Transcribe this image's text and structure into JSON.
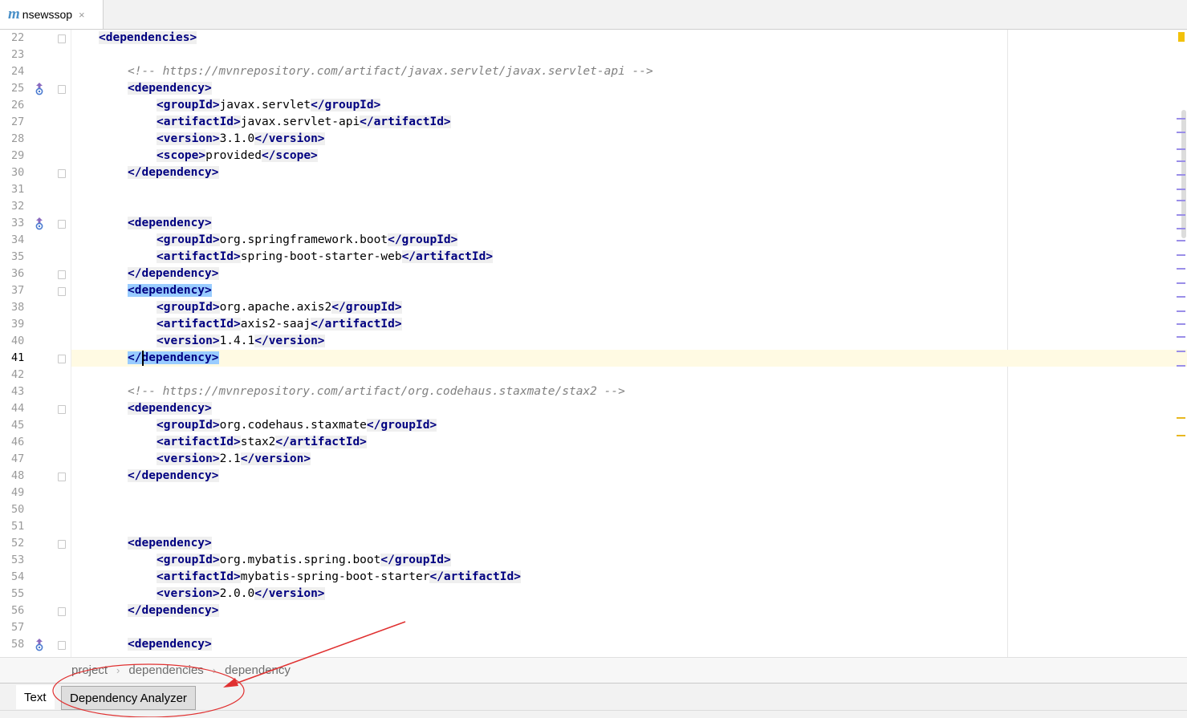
{
  "tab": {
    "icon": "maven-icon",
    "filename": "nsewssop",
    "close_symbol": "×"
  },
  "lines": [
    {
      "n": "22",
      "fold": true,
      "icon": false,
      "indent": 1,
      "segments": [
        [
          "t",
          "<dependencies>"
        ]
      ]
    },
    {
      "n": "23",
      "fold": false,
      "icon": false,
      "indent": 0,
      "segments": []
    },
    {
      "n": "24",
      "fold": false,
      "icon": false,
      "indent": 2,
      "segments": [
        [
          "c",
          "<!-- https://mvnrepository.com/artifact/javax.servlet/javax.servlet-api -->"
        ]
      ]
    },
    {
      "n": "25",
      "fold": true,
      "icon": true,
      "indent": 2,
      "segments": [
        [
          "t",
          "<dependency>"
        ]
      ]
    },
    {
      "n": "26",
      "fold": false,
      "icon": false,
      "indent": 3,
      "segments": [
        [
          "t",
          "<groupId>"
        ],
        [
          "x",
          "javax.servlet"
        ],
        [
          "t",
          "</groupId>"
        ]
      ]
    },
    {
      "n": "27",
      "fold": false,
      "icon": false,
      "indent": 3,
      "segments": [
        [
          "t",
          "<artifactId>"
        ],
        [
          "x",
          "javax.servlet-api"
        ],
        [
          "t",
          "</artifactId>"
        ]
      ]
    },
    {
      "n": "28",
      "fold": false,
      "icon": false,
      "indent": 3,
      "segments": [
        [
          "t",
          "<version>"
        ],
        [
          "x",
          "3.1.0"
        ],
        [
          "t",
          "</version>"
        ]
      ]
    },
    {
      "n": "29",
      "fold": false,
      "icon": false,
      "indent": 3,
      "segments": [
        [
          "t",
          "<scope>"
        ],
        [
          "x",
          "provided"
        ],
        [
          "t",
          "</scope>"
        ]
      ]
    },
    {
      "n": "30",
      "fold": true,
      "icon": false,
      "indent": 2,
      "segments": [
        [
          "t",
          "</dependency>"
        ]
      ]
    },
    {
      "n": "31",
      "fold": false,
      "icon": false,
      "indent": 0,
      "segments": []
    },
    {
      "n": "32",
      "fold": false,
      "icon": false,
      "indent": 0,
      "segments": []
    },
    {
      "n": "33",
      "fold": true,
      "icon": true,
      "indent": 2,
      "segments": [
        [
          "t",
          "<dependency>"
        ]
      ]
    },
    {
      "n": "34",
      "fold": false,
      "icon": false,
      "indent": 3,
      "segments": [
        [
          "t",
          "<groupId>"
        ],
        [
          "x",
          "org.springframework.boot"
        ],
        [
          "t",
          "</groupId>"
        ]
      ]
    },
    {
      "n": "35",
      "fold": false,
      "icon": false,
      "indent": 3,
      "segments": [
        [
          "t",
          "<artifactId>"
        ],
        [
          "x",
          "spring-boot-starter-web"
        ],
        [
          "t",
          "</artifactId>"
        ]
      ]
    },
    {
      "n": "36",
      "fold": true,
      "icon": false,
      "indent": 2,
      "segments": [
        [
          "t",
          "</dependency>"
        ]
      ]
    },
    {
      "n": "37",
      "fold": true,
      "icon": false,
      "indent": 2,
      "segments": [
        [
          "h",
          "<dependency>"
        ]
      ]
    },
    {
      "n": "38",
      "fold": false,
      "icon": false,
      "indent": 3,
      "segments": [
        [
          "t",
          "<groupId>"
        ],
        [
          "x",
          "org.apache.axis2"
        ],
        [
          "t",
          "</groupId>"
        ]
      ]
    },
    {
      "n": "39",
      "fold": false,
      "icon": false,
      "indent": 3,
      "segments": [
        [
          "t",
          "<artifactId>"
        ],
        [
          "x",
          "axis2-saaj"
        ],
        [
          "t",
          "</artifactId>"
        ]
      ]
    },
    {
      "n": "40",
      "fold": false,
      "icon": false,
      "indent": 3,
      "segments": [
        [
          "t",
          "<version>"
        ],
        [
          "x",
          "1.4.1"
        ],
        [
          "t",
          "</version>"
        ]
      ]
    },
    {
      "n": "41",
      "fold": true,
      "icon": false,
      "indent": 2,
      "current": true,
      "segments": [
        [
          "h",
          "</dependency>"
        ]
      ]
    },
    {
      "n": "42",
      "fold": false,
      "icon": false,
      "indent": 0,
      "segments": []
    },
    {
      "n": "43",
      "fold": false,
      "icon": false,
      "indent": 2,
      "segments": [
        [
          "c",
          "<!-- https://mvnrepository.com/artifact/org.codehaus.staxmate/stax2 -->"
        ]
      ]
    },
    {
      "n": "44",
      "fold": true,
      "icon": false,
      "indent": 2,
      "segments": [
        [
          "t",
          "<dependency>"
        ]
      ]
    },
    {
      "n": "45",
      "fold": false,
      "icon": false,
      "indent": 3,
      "segments": [
        [
          "t",
          "<groupId>"
        ],
        [
          "x",
          "org.codehaus.staxmate"
        ],
        [
          "t",
          "</groupId>"
        ]
      ]
    },
    {
      "n": "46",
      "fold": false,
      "icon": false,
      "indent": 3,
      "segments": [
        [
          "t",
          "<artifactId>"
        ],
        [
          "x",
          "stax2"
        ],
        [
          "t",
          "</artifactId>"
        ]
      ]
    },
    {
      "n": "47",
      "fold": false,
      "icon": false,
      "indent": 3,
      "segments": [
        [
          "t",
          "<version>"
        ],
        [
          "x",
          "2.1"
        ],
        [
          "t",
          "</version>"
        ]
      ]
    },
    {
      "n": "48",
      "fold": true,
      "icon": false,
      "indent": 2,
      "segments": [
        [
          "t",
          "</dependency>"
        ]
      ]
    },
    {
      "n": "49",
      "fold": false,
      "icon": false,
      "indent": 0,
      "segments": []
    },
    {
      "n": "50",
      "fold": false,
      "icon": false,
      "indent": 0,
      "segments": []
    },
    {
      "n": "51",
      "fold": false,
      "icon": false,
      "indent": 0,
      "segments": []
    },
    {
      "n": "52",
      "fold": true,
      "icon": false,
      "indent": 2,
      "segments": [
        [
          "t",
          "<dependency>"
        ]
      ]
    },
    {
      "n": "53",
      "fold": false,
      "icon": false,
      "indent": 3,
      "segments": [
        [
          "t",
          "<groupId>"
        ],
        [
          "x",
          "org.mybatis.spring.boot"
        ],
        [
          "t",
          "</groupId>"
        ]
      ]
    },
    {
      "n": "54",
      "fold": false,
      "icon": false,
      "indent": 3,
      "segments": [
        [
          "t",
          "<artifactId>"
        ],
        [
          "x",
          "mybatis-spring-boot-starter"
        ],
        [
          "t",
          "</artifactId>"
        ]
      ]
    },
    {
      "n": "55",
      "fold": false,
      "icon": false,
      "indent": 3,
      "segments": [
        [
          "t",
          "<version>"
        ],
        [
          "x",
          "2.0.0"
        ],
        [
          "t",
          "</version>"
        ]
      ]
    },
    {
      "n": "56",
      "fold": true,
      "icon": false,
      "indent": 2,
      "segments": [
        [
          "t",
          "</dependency>"
        ]
      ]
    },
    {
      "n": "57",
      "fold": false,
      "icon": false,
      "indent": 0,
      "segments": []
    },
    {
      "n": "58",
      "fold": true,
      "icon": true,
      "indent": 2,
      "segments": [
        [
          "t",
          "<dependency>"
        ]
      ]
    }
  ],
  "breadcrumb": {
    "items": [
      "project",
      "dependencies",
      "dependency"
    ],
    "separator": "›"
  },
  "bottom_tabs": {
    "text": "Text",
    "dependency_analyzer": "Dependency Analyzer"
  },
  "colors": {
    "tag": "#000080",
    "comment": "#808080",
    "current_line": "#fffae3",
    "brace_match": "#99ccff",
    "annotation": "#e03030"
  }
}
